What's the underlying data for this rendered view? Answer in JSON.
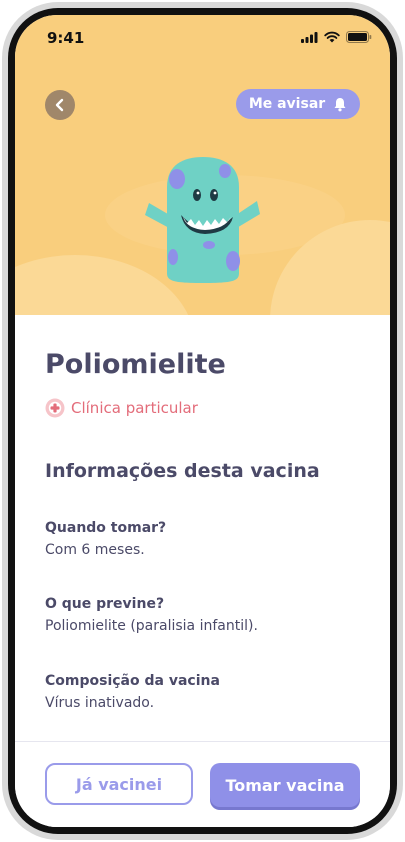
{
  "status_bar": {
    "time": "9:41"
  },
  "header": {
    "notify_label": "Me avisar"
  },
  "vaccine": {
    "name": "Poliomielite",
    "clinic_type": "Clínica particular"
  },
  "info": {
    "section_title": "Informações desta vacina",
    "items": [
      {
        "label": "Quando tomar?",
        "value": "Com 6 meses."
      },
      {
        "label": "O que previne?",
        "value": "Poliomielite (paralisia infantil)."
      },
      {
        "label": "Composição da vacina",
        "value": "Vírus inativado."
      }
    ]
  },
  "actions": {
    "already_label": "Já vacinei",
    "take_label": "Tomar vacina"
  },
  "colors": {
    "hero_bg": "#f9ce7d",
    "accent": "#9a9bea",
    "title_text": "#4b4a68",
    "clinic_pink": "#e36c7a",
    "mascot_teal": "#6fd1c5",
    "mascot_spots": "#8f90e8"
  },
  "icons": {
    "back": "chevron-left-icon",
    "notify": "bell-icon",
    "clinic": "clinic-badge-icon"
  }
}
